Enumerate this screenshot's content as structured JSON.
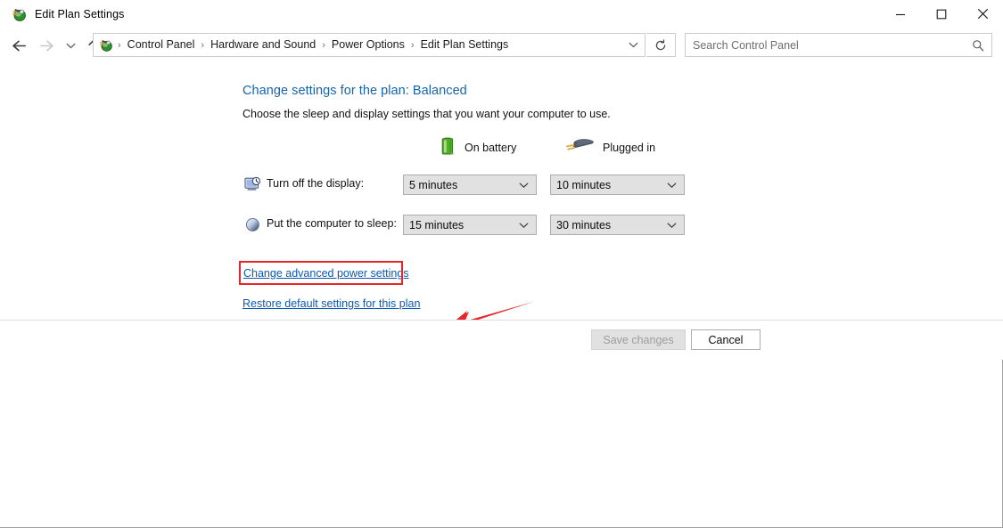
{
  "window": {
    "title": "Edit Plan Settings",
    "icon": "power-plan-icon",
    "minimize_label": "Minimize",
    "maximize_label": "Maximize",
    "close_label": "Close"
  },
  "navbar": {
    "back_label": "Back",
    "forward_label": "Forward",
    "recent_label": "Recent locations",
    "up_label": "Up one level",
    "refresh_label": "Refresh",
    "breadcrumb": [
      "Control Panel",
      "Hardware and Sound",
      "Power Options",
      "Edit Plan Settings"
    ],
    "separator": "›",
    "dropdown_label": "Previous locations"
  },
  "search": {
    "placeholder": "Search Control Panel",
    "icon": "search-icon"
  },
  "page": {
    "heading": "Change settings for the plan: Balanced",
    "subheading": "Choose the sleep and display settings that you want your computer to use."
  },
  "columns": [
    {
      "key": "battery",
      "label": "On battery",
      "icon": "battery-icon"
    },
    {
      "key": "plugged",
      "label": "Plugged in",
      "icon": "power-plug-icon"
    }
  ],
  "settings": [
    {
      "icon": "display-clock-icon",
      "label": "Turn off the display:",
      "battery_value": "5 minutes",
      "plugged_value": "10 minutes"
    },
    {
      "icon": "sleep-moon-icon",
      "label": "Put the computer to sleep:",
      "battery_value": "15 minutes",
      "plugged_value": "30 minutes"
    }
  ],
  "links": {
    "advanced": "Change advanced power settings",
    "restore": "Restore default settings for this plan"
  },
  "annotation": {
    "highlight_color": "#e8262a",
    "arrow_color": "#e8262a",
    "highlight_target": "Change advanced power settings"
  },
  "footer": {
    "save_label": "Save changes",
    "save_enabled": false,
    "cancel_label": "Cancel"
  },
  "colors": {
    "heading": "#1764a8",
    "link": "#0b59b3",
    "combo_bg": "#e1e1e1",
    "combo_border": "#adadad",
    "window_bg": "#ffffff"
  }
}
